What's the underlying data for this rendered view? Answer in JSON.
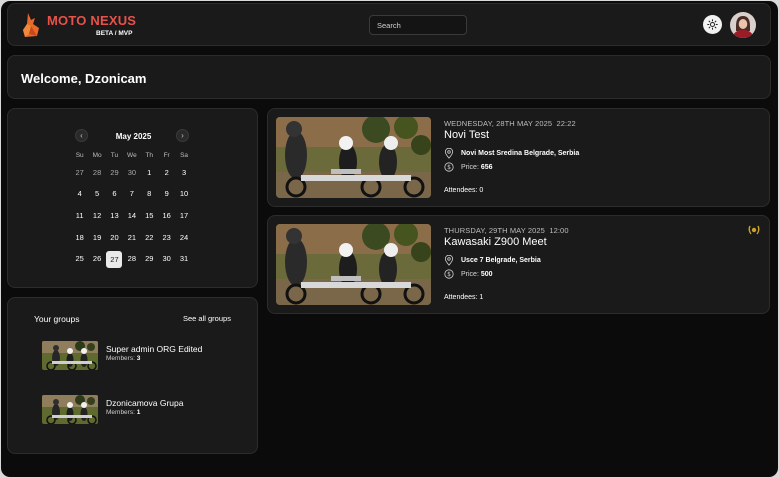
{
  "header": {
    "brand": "MOTO NEXUS",
    "brand_sub": "BETA / MVP",
    "search_placeholder": "Search",
    "icons": {
      "logo": "fox-logo-icon",
      "theme": "sun-icon",
      "avatar": "user-avatar"
    },
    "colors": {
      "brand": "#e8524a",
      "logo": "#e8692a"
    }
  },
  "welcome": {
    "text": "Welcome, Dzonicam"
  },
  "calendar": {
    "month": "May 2025",
    "weekdays": [
      "Su",
      "Mo",
      "Tu",
      "We",
      "Th",
      "Fr",
      "Sa"
    ],
    "weeks": [
      [
        {
          "d": "27",
          "m": true
        },
        {
          "d": "28",
          "m": true
        },
        {
          "d": "29",
          "m": true
        },
        {
          "d": "30",
          "m": true
        },
        {
          "d": "1"
        },
        {
          "d": "2"
        },
        {
          "d": "3"
        }
      ],
      [
        {
          "d": "4"
        },
        {
          "d": "5"
        },
        {
          "d": "6"
        },
        {
          "d": "7"
        },
        {
          "d": "8"
        },
        {
          "d": "9"
        },
        {
          "d": "10"
        }
      ],
      [
        {
          "d": "11"
        },
        {
          "d": "12"
        },
        {
          "d": "13"
        },
        {
          "d": "14"
        },
        {
          "d": "15"
        },
        {
          "d": "16"
        },
        {
          "d": "17"
        }
      ],
      [
        {
          "d": "18"
        },
        {
          "d": "19"
        },
        {
          "d": "20"
        },
        {
          "d": "21"
        },
        {
          "d": "22"
        },
        {
          "d": "23"
        },
        {
          "d": "24"
        }
      ],
      [
        {
          "d": "25"
        },
        {
          "d": "26"
        },
        {
          "d": "27",
          "today": true
        },
        {
          "d": "28"
        },
        {
          "d": "29"
        },
        {
          "d": "30"
        },
        {
          "d": "31"
        }
      ]
    ]
  },
  "groups": {
    "title": "Your groups",
    "see_all": "See all groups",
    "members_label": "Members:",
    "items": [
      {
        "name": "Super admin ORG Edited",
        "members": "3"
      },
      {
        "name": "Dzonicamova Grupa",
        "members": "1"
      }
    ]
  },
  "events": {
    "price_label": "Price:",
    "attendees_label": "Attendees:",
    "items": [
      {
        "date": "WEDNESDAY, 28TH MAY 2025",
        "time": "22:22",
        "title": "Novi Test",
        "location": "Novi Most Sredina Belgrade, Serbia",
        "price": "656",
        "attendees": "0",
        "award": false
      },
      {
        "date": "THURSDAY, 29TH MAY 2025",
        "time": "12:00",
        "title": "Kawasaki Z900 Meet",
        "location": "Usce 7 Belgrade, Serbia",
        "price": "500",
        "attendees": "1",
        "award": true
      }
    ],
    "icons": {
      "location": "map-pin-icon",
      "price": "dollar-circle-icon",
      "award": "laurel-award-icon"
    },
    "colors": {
      "award": "#c9a227"
    }
  }
}
